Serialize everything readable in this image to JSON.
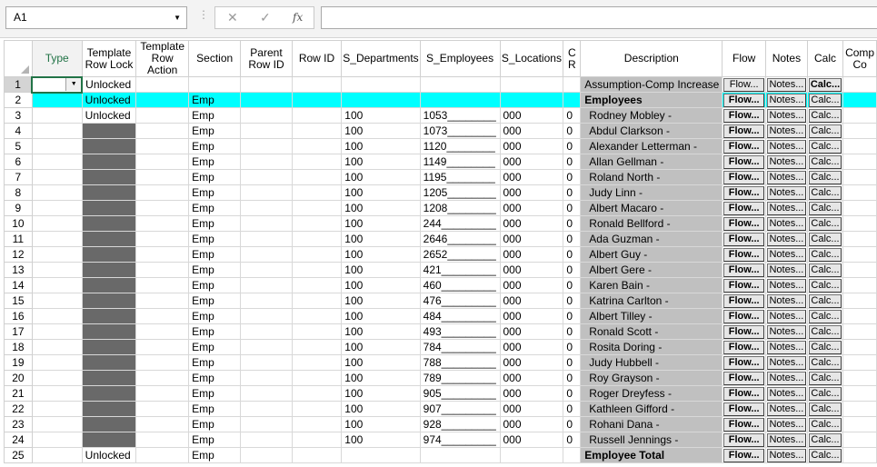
{
  "formula_bar": {
    "name_box": "A1",
    "cancel_icon": "✕",
    "enter_icon": "✓",
    "fx_label": "fx",
    "formula": ""
  },
  "columns": [
    "Type",
    "Template Row Lock",
    "Template Row Action",
    "Section",
    "Parent Row ID",
    "Row ID",
    "S_Departments",
    "S_Employees",
    "S_Locations",
    "C R",
    "Description",
    "Flow",
    "Notes",
    "Calc",
    "Comp Co"
  ],
  "rows": [
    {
      "n": "1",
      "lock": "Unlocked",
      "section": "",
      "dept": "",
      "emp": "",
      "loc": "",
      "cr": "",
      "desc": "Assumption-Comp Increase",
      "flow": "Flow...",
      "notes": "Notes...",
      "calc": "Calc..."
    },
    {
      "n": "2",
      "lock": "Unlocked",
      "section": "Emp",
      "dept": "",
      "emp": "",
      "loc": "",
      "cr": "",
      "desc": "Employees",
      "flow": "Flow...",
      "notes": "Notes...",
      "calc": "Calc..."
    },
    {
      "n": "3",
      "lock": "Unlocked",
      "section": "Emp",
      "dept": "100",
      "emp": "1053________",
      "loc": "000",
      "cr": "0",
      "desc": "Rodney Mobley -",
      "flow": "Flow...",
      "notes": "Notes...",
      "calc": "Calc..."
    },
    {
      "n": "4",
      "lock": "",
      "section": "Emp",
      "dept": "100",
      "emp": "1073________",
      "loc": "000",
      "cr": "0",
      "desc": "Abdul Clarkson -",
      "flow": "Flow...",
      "notes": "Notes...",
      "calc": "Calc..."
    },
    {
      "n": "5",
      "lock": "",
      "section": "Emp",
      "dept": "100",
      "emp": "1120________",
      "loc": "000",
      "cr": "0",
      "desc": "Alexander Letterman -",
      "flow": "Flow...",
      "notes": "Notes...",
      "calc": "Calc..."
    },
    {
      "n": "6",
      "lock": "",
      "section": "Emp",
      "dept": "100",
      "emp": "1149________",
      "loc": "000",
      "cr": "0",
      "desc": "Allan Gellman -",
      "flow": "Flow...",
      "notes": "Notes...",
      "calc": "Calc..."
    },
    {
      "n": "7",
      "lock": "",
      "section": "Emp",
      "dept": "100",
      "emp": "1195________",
      "loc": "000",
      "cr": "0",
      "desc": "Roland North -",
      "flow": "Flow...",
      "notes": "Notes...",
      "calc": "Calc..."
    },
    {
      "n": "8",
      "lock": "",
      "section": "Emp",
      "dept": "100",
      "emp": "1205________",
      "loc": "000",
      "cr": "0",
      "desc": "Judy Linn -",
      "flow": "Flow...",
      "notes": "Notes...",
      "calc": "Calc..."
    },
    {
      "n": "9",
      "lock": "",
      "section": "Emp",
      "dept": "100",
      "emp": "1208________",
      "loc": "000",
      "cr": "0",
      "desc": "Albert Macaro -",
      "flow": "Flow...",
      "notes": "Notes...",
      "calc": "Calc..."
    },
    {
      "n": "10",
      "lock": "",
      "section": "Emp",
      "dept": "100",
      "emp": "244_________",
      "loc": "000",
      "cr": "0",
      "desc": "Ronald Bellford -",
      "flow": "Flow...",
      "notes": "Notes...",
      "calc": "Calc..."
    },
    {
      "n": "11",
      "lock": "",
      "section": "Emp",
      "dept": "100",
      "emp": "2646________",
      "loc": "000",
      "cr": "0",
      "desc": "Ada Guzman -",
      "flow": "Flow...",
      "notes": "Notes...",
      "calc": "Calc..."
    },
    {
      "n": "12",
      "lock": "",
      "section": "Emp",
      "dept": "100",
      "emp": "2652________",
      "loc": "000",
      "cr": "0",
      "desc": "Albert Guy -",
      "flow": "Flow...",
      "notes": "Notes...",
      "calc": "Calc..."
    },
    {
      "n": "13",
      "lock": "",
      "section": "Emp",
      "dept": "100",
      "emp": "421_________",
      "loc": "000",
      "cr": "0",
      "desc": "Albert Gere -",
      "flow": "Flow...",
      "notes": "Notes...",
      "calc": "Calc..."
    },
    {
      "n": "14",
      "lock": "",
      "section": "Emp",
      "dept": "100",
      "emp": "460_________",
      "loc": "000",
      "cr": "0",
      "desc": "Karen Bain -",
      "flow": "Flow...",
      "notes": "Notes...",
      "calc": "Calc..."
    },
    {
      "n": "15",
      "lock": "",
      "section": "Emp",
      "dept": "100",
      "emp": "476_________",
      "loc": "000",
      "cr": "0",
      "desc": "Katrina Carlton -",
      "flow": "Flow...",
      "notes": "Notes...",
      "calc": "Calc..."
    },
    {
      "n": "16",
      "lock": "",
      "section": "Emp",
      "dept": "100",
      "emp": "484_________",
      "loc": "000",
      "cr": "0",
      "desc": "Albert Tilley -",
      "flow": "Flow...",
      "notes": "Notes...",
      "calc": "Calc..."
    },
    {
      "n": "17",
      "lock": "",
      "section": "Emp",
      "dept": "100",
      "emp": "493_________",
      "loc": "000",
      "cr": "0",
      "desc": "Ronald Scott -",
      "flow": "Flow...",
      "notes": "Notes...",
      "calc": "Calc..."
    },
    {
      "n": "18",
      "lock": "",
      "section": "Emp",
      "dept": "100",
      "emp": "784_________",
      "loc": "000",
      "cr": "0",
      "desc": "Rosita Doring -",
      "flow": "Flow...",
      "notes": "Notes...",
      "calc": "Calc..."
    },
    {
      "n": "19",
      "lock": "",
      "section": "Emp",
      "dept": "100",
      "emp": "788_________",
      "loc": "000",
      "cr": "0",
      "desc": "Judy Hubbell -",
      "flow": "Flow...",
      "notes": "Notes...",
      "calc": "Calc..."
    },
    {
      "n": "20",
      "lock": "",
      "section": "Emp",
      "dept": "100",
      "emp": "789_________",
      "loc": "000",
      "cr": "0",
      "desc": "Roy Grayson -",
      "flow": "Flow...",
      "notes": "Notes...",
      "calc": "Calc..."
    },
    {
      "n": "21",
      "lock": "",
      "section": "Emp",
      "dept": "100",
      "emp": "905_________",
      "loc": "000",
      "cr": "0",
      "desc": "Roger Dreyfess -",
      "flow": "Flow...",
      "notes": "Notes...",
      "calc": "Calc..."
    },
    {
      "n": "22",
      "lock": "",
      "section": "Emp",
      "dept": "100",
      "emp": "907_________",
      "loc": "000",
      "cr": "0",
      "desc": "Kathleen Gifford -",
      "flow": "Flow...",
      "notes": "Notes...",
      "calc": "Calc..."
    },
    {
      "n": "23",
      "lock": "",
      "section": "Emp",
      "dept": "100",
      "emp": "928_________",
      "loc": "000",
      "cr": "0",
      "desc": "Rohani Dana -",
      "flow": "Flow...",
      "notes": "Notes...",
      "calc": "Calc..."
    },
    {
      "n": "24",
      "lock": "",
      "section": "Emp",
      "dept": "100",
      "emp": "974_________",
      "loc": "000",
      "cr": "0",
      "desc": "Russell Jennings -",
      "flow": "Flow...",
      "notes": "Notes...",
      "calc": "Calc..."
    },
    {
      "n": "25",
      "lock": "Unlocked",
      "section": "Emp",
      "dept": "",
      "emp": "",
      "loc": "",
      "cr": "",
      "desc": "Employee Total",
      "flow": "Flow...",
      "notes": "Notes...",
      "calc": "Calc..."
    }
  ],
  "colors": {
    "highlight_row": "#00ffff",
    "locked_cell": "#696969",
    "description_bg": "#c0c0c0",
    "selection": "#217346"
  }
}
